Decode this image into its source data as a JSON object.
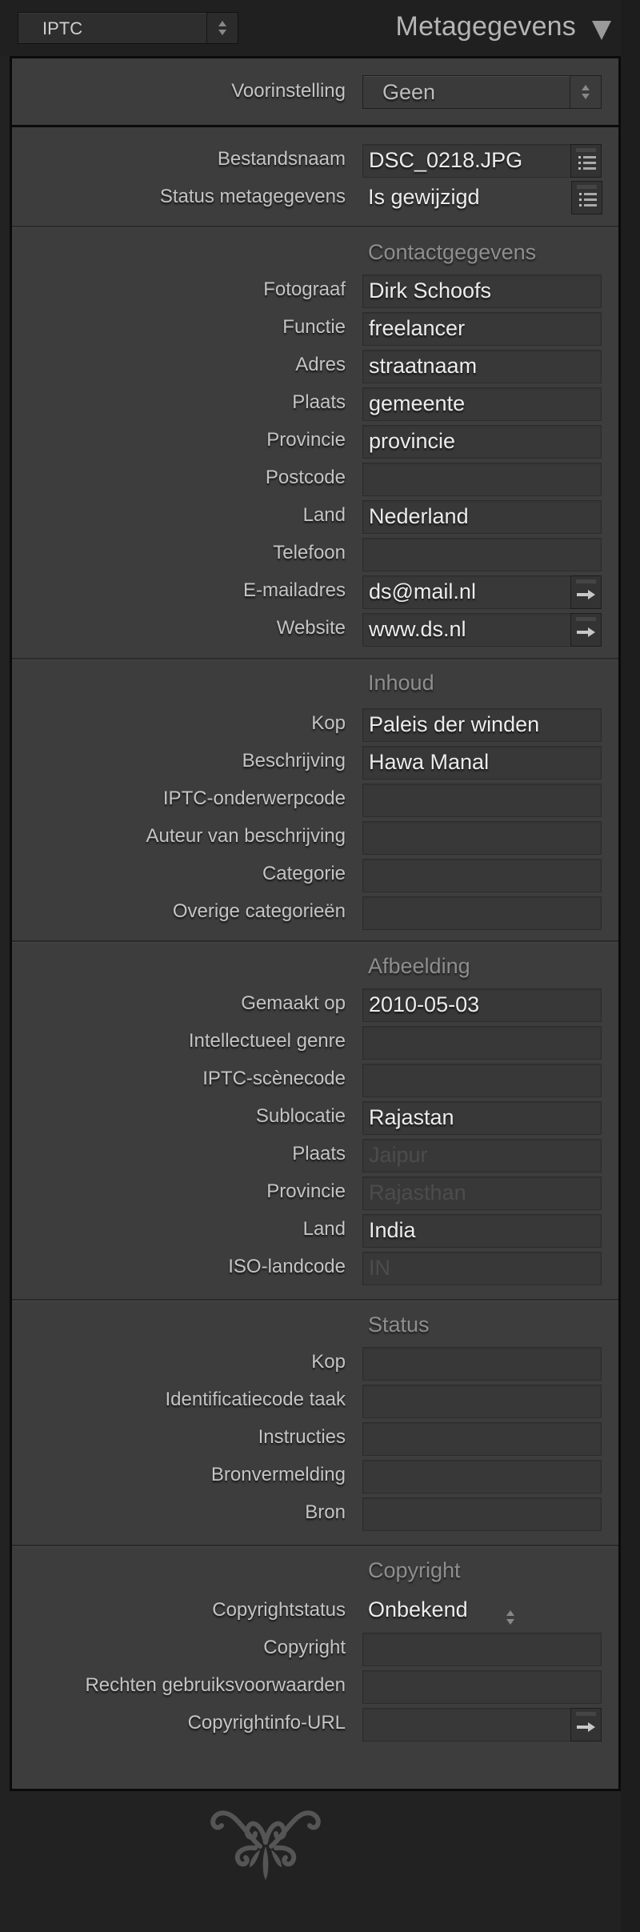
{
  "header": {
    "view_select": "IPTC",
    "panel_title": "Metagegevens"
  },
  "preset": {
    "label": "Voorinstelling",
    "value": "Geen"
  },
  "file_info": [
    {
      "label": "Bestandsnaam",
      "value": "DSC_0218.JPG",
      "button": "list-icon"
    },
    {
      "label": "Status metagegevens",
      "value": "Is gewijzigd",
      "button": "list-icon"
    }
  ],
  "sections": {
    "contact": {
      "title": "Contactgegevens",
      "rows": [
        {
          "label": "Fotograaf",
          "value": "Dirk Schoofs"
        },
        {
          "label": "Functie",
          "value": "freelancer"
        },
        {
          "label": "Adres",
          "value": "straatnaam"
        },
        {
          "label": "Plaats",
          "value": "gemeente"
        },
        {
          "label": "Provincie",
          "value": "provincie"
        },
        {
          "label": "Postcode",
          "value": ""
        },
        {
          "label": "Land",
          "value": "Nederland"
        },
        {
          "label": "Telefoon",
          "value": ""
        },
        {
          "label": "E-mailadres",
          "value": "ds@mail.nl",
          "button": "arrow-icon"
        },
        {
          "label": "Website",
          "value": "www.ds.nl",
          "button": "arrow-icon"
        }
      ]
    },
    "content": {
      "title": "Inhoud",
      "rows": [
        {
          "label": "Kop",
          "value": "Paleis der winden"
        },
        {
          "label": "Beschrijving",
          "value": "Hawa Manal"
        },
        {
          "label": "IPTC-onderwerpcode",
          "value": ""
        },
        {
          "label": "Auteur van beschrijving",
          "value": ""
        },
        {
          "label": "Categorie",
          "value": ""
        },
        {
          "label": "Overige categorieën",
          "value": ""
        }
      ]
    },
    "image": {
      "title": "Afbeelding",
      "rows": [
        {
          "label": "Gemaakt op",
          "value": "2010-05-03"
        },
        {
          "label": "Intellectueel genre",
          "value": ""
        },
        {
          "label": "IPTC-scènecode",
          "value": ""
        },
        {
          "label": "Sublocatie",
          "value": "Rajastan"
        },
        {
          "label": "Plaats",
          "value": "Jaipur",
          "dimmed": true
        },
        {
          "label": "Provincie",
          "value": "Rajasthan",
          "dimmed": true
        },
        {
          "label": "Land",
          "value": "India"
        },
        {
          "label": "ISO-landcode",
          "value": "IN",
          "dimmed": true
        }
      ]
    },
    "status": {
      "title": "Status",
      "rows": [
        {
          "label": "Kop",
          "value": ""
        },
        {
          "label": "Identificatiecode taak",
          "value": ""
        },
        {
          "label": "Instructies",
          "value": ""
        },
        {
          "label": "Bronvermelding",
          "value": ""
        },
        {
          "label": "Bron",
          "value": ""
        }
      ]
    },
    "copyright": {
      "title": "Copyright",
      "status_label": "Copyrightstatus",
      "status_value": "Onbekend",
      "rows": [
        {
          "label": "Copyright",
          "value": ""
        },
        {
          "label": "Rechten gebruiksvoorwaarden",
          "value": ""
        },
        {
          "label": "Copyrightinfo-URL",
          "value": "",
          "button": "arrow-icon"
        }
      ]
    }
  },
  "colors": {
    "background": "#222222",
    "panel": "#3d3d3d",
    "field": "#383838",
    "label_text": "#c4c4c4",
    "value_text": "#ececec",
    "section_header": "#8e8e8e",
    "dimmed_value": "#4c4c4c"
  }
}
